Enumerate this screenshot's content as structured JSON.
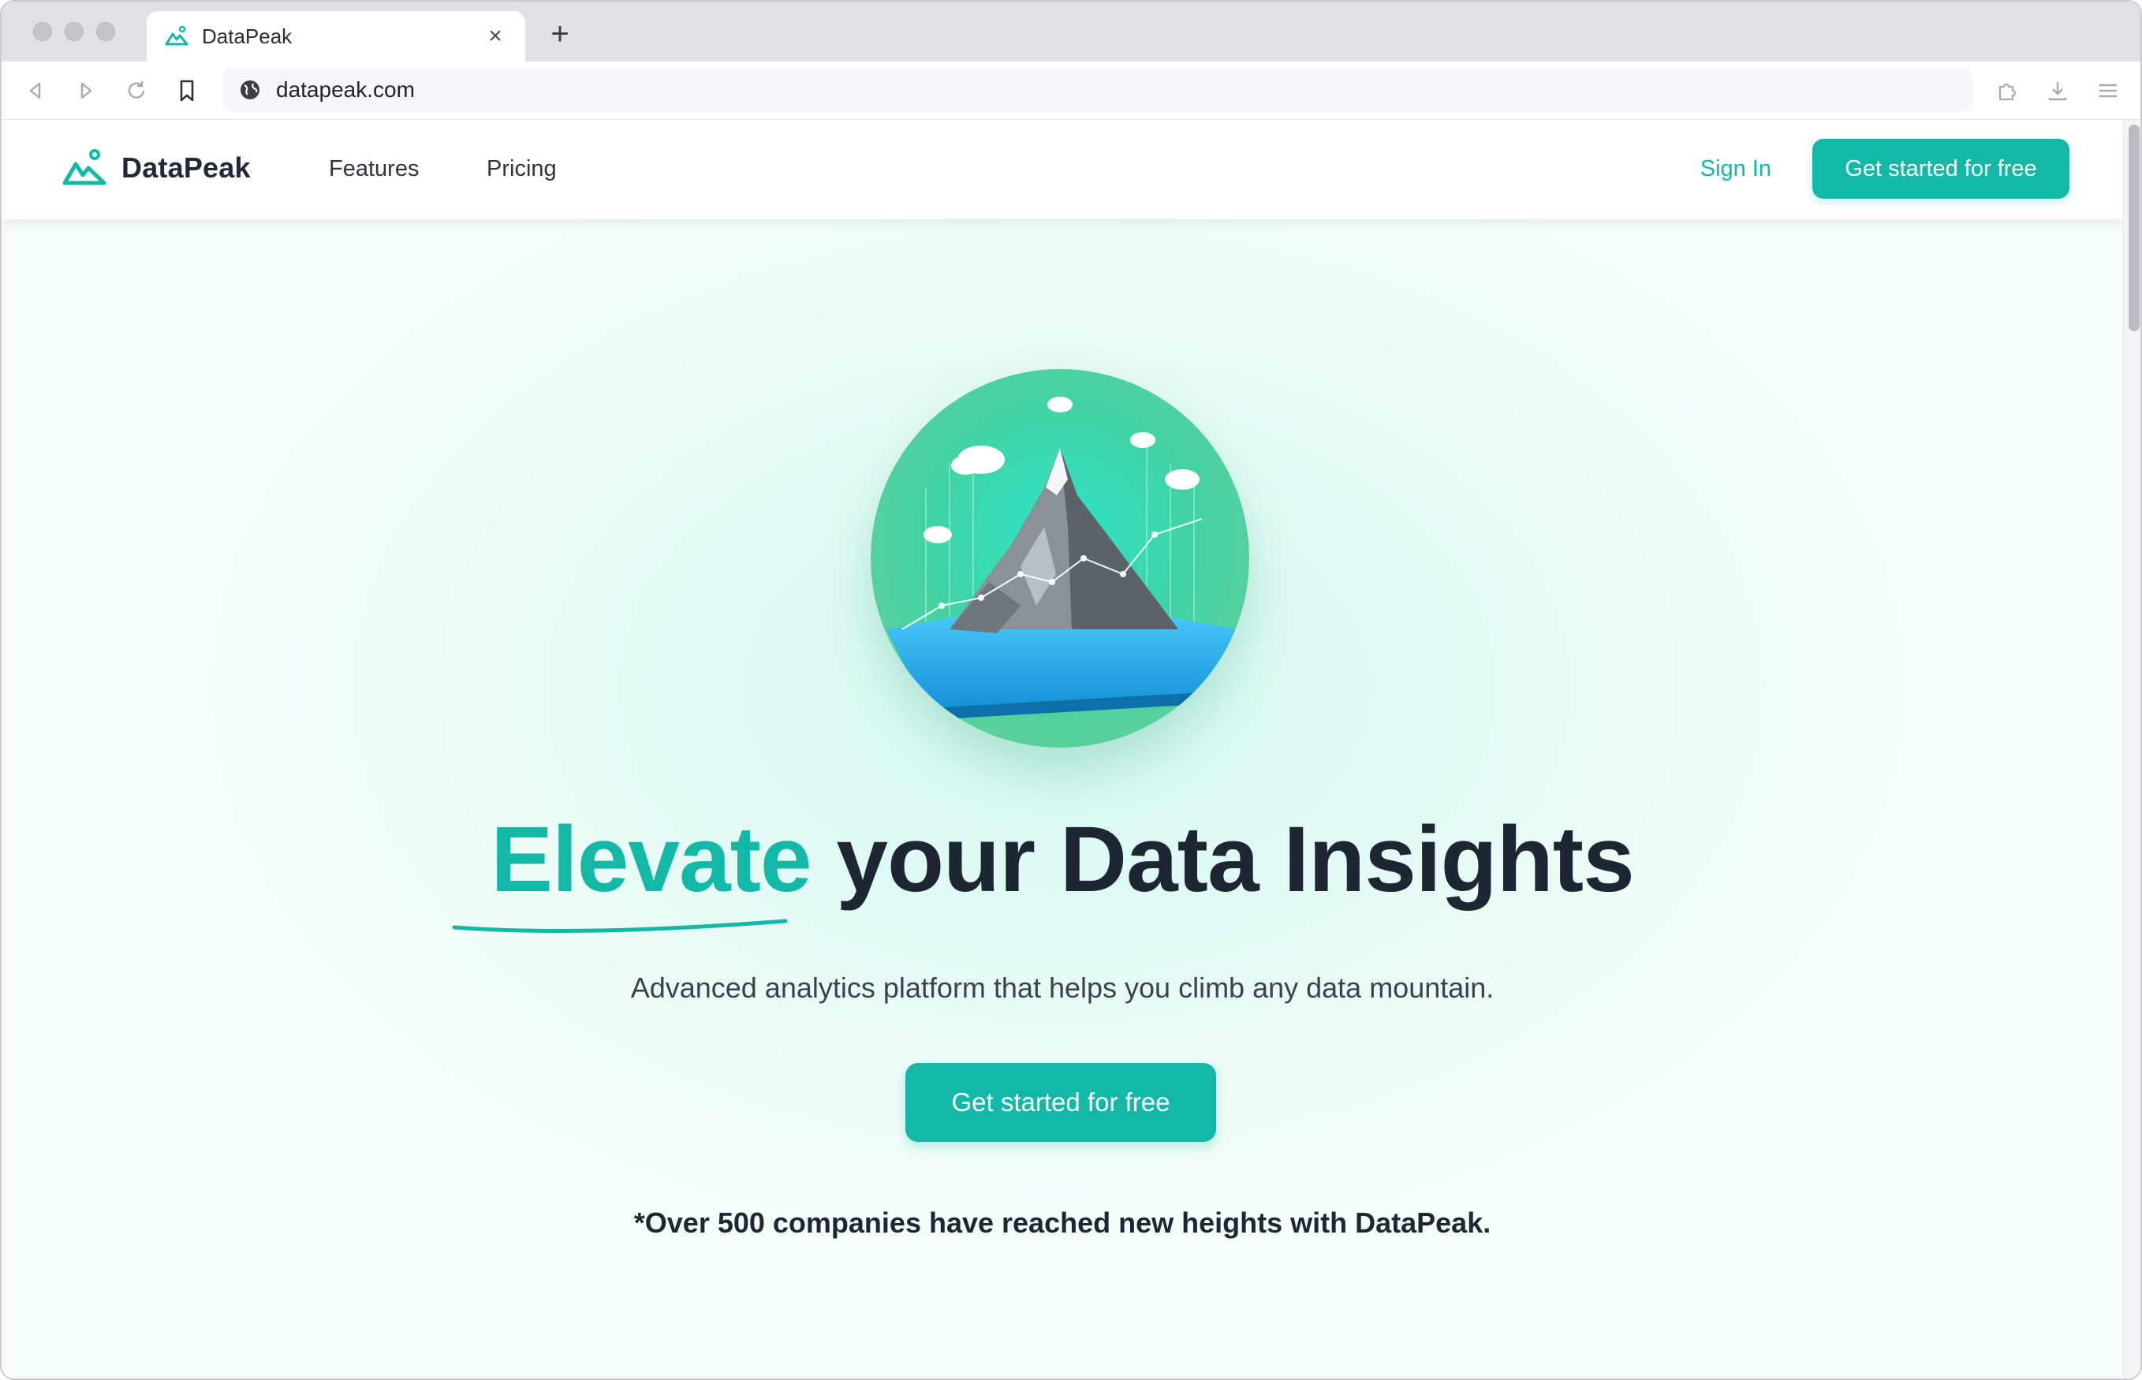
{
  "browser": {
    "tab_title": "DataPeak",
    "tab_close": "×",
    "new_tab": "+",
    "url": "datapeak.com"
  },
  "site": {
    "brand_name": "DataPeak",
    "nav_links": [
      "Features",
      "Pricing"
    ],
    "sign_in": "Sign In",
    "nav_cta": "Get started for free"
  },
  "hero": {
    "headline_accent": "Elevate",
    "headline_rest": "your Data Insights",
    "subheadline": "Advanced analytics platform that helps you climb any data mountain.",
    "cta": "Get started for free",
    "social_proof": "*Over 500 companies have reached new heights with DataPeak."
  },
  "colors": {
    "brand_teal": "#14b8a6",
    "heading_dark": "#1e2633"
  },
  "icons": {
    "tab": "mountain-logo-icon",
    "back": "back-arrow-icon",
    "forward": "forward-arrow-icon",
    "reload": "reload-icon",
    "bookmark": "bookmark-icon",
    "site_info": "globe-icon",
    "extensions": "puzzle-icon",
    "downloads": "download-icon",
    "menu": "hamburger-menu-icon"
  }
}
